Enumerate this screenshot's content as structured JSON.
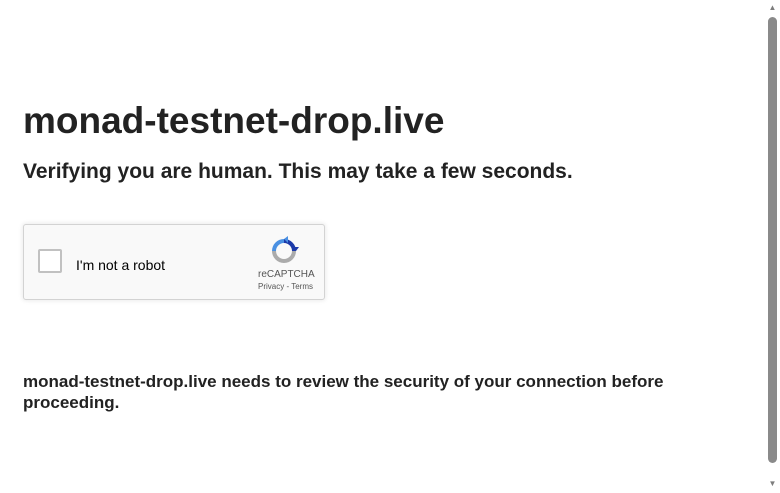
{
  "page": {
    "site_title": "monad-testnet-drop.live",
    "subtitle": "Verifying you are human. This may take a few seconds.",
    "notice": "monad-testnet-drop.live needs to review the security of your connection before proceeding."
  },
  "captcha": {
    "checkbox_label": "I'm not a robot",
    "checked": false,
    "brand": "reCAPTCHA",
    "privacy_link": "Privacy",
    "separator": " - ",
    "terms_link": "Terms",
    "logo_icon": "recaptcha-logo-icon"
  },
  "scrollbar": {
    "up_arrow": "▲",
    "down_arrow": "▼"
  },
  "colors": {
    "text": "#222222",
    "captcha_border": "#d3d3d3",
    "captcha_bg": "#f9f9f9",
    "recaptcha_blue": "#1c3aa9",
    "recaptcha_light_blue": "#4a90e2",
    "recaptcha_gray": "#ababab"
  }
}
